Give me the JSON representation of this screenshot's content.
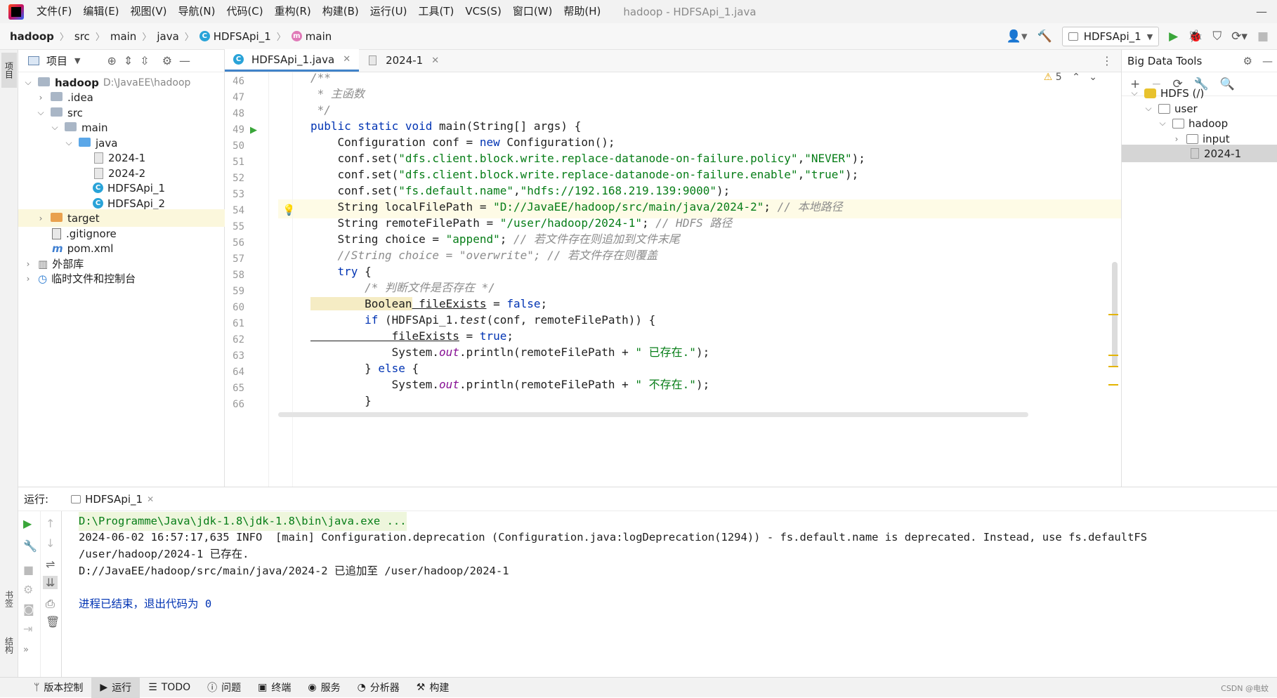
{
  "titlebar": {
    "menus": [
      "文件(F)",
      "编辑(E)",
      "视图(V)",
      "导航(N)",
      "代码(C)",
      "重构(R)",
      "构建(B)",
      "运行(U)",
      "工具(T)",
      "VCS(S)",
      "窗口(W)",
      "帮助(H)"
    ],
    "window_title": "hadoop - HDFSApi_1.java"
  },
  "breadcrumb": {
    "items": [
      "hadoop",
      "src",
      "main",
      "java",
      "HDFSApi_1",
      "main"
    ]
  },
  "run_toolbar": {
    "config": "HDFSApi_1"
  },
  "left_strip": {
    "project": "项目",
    "bookmarks": "书签",
    "structure": "结构"
  },
  "project": {
    "header": "项目",
    "root_name": "hadoop",
    "root_path": "D:\\JavaEE\\hadoop",
    "items": [
      ".idea",
      "src",
      "main",
      "java",
      "2024-1",
      "2024-2",
      "HDFSApi_1",
      "HDFSApi_2",
      "target",
      ".gitignore",
      "pom.xml",
      "外部库",
      "临时文件和控制台"
    ]
  },
  "tabs": [
    {
      "label": "HDFSApi_1.java"
    },
    {
      "label": "2024-1"
    }
  ],
  "editor": {
    "warnings": "5",
    "line_numbers": [
      "46",
      "47",
      "48",
      "49",
      "50",
      "51",
      "52",
      "53",
      "54",
      "55",
      "56",
      "57",
      "58",
      "59",
      "60",
      "61",
      "62",
      "63",
      "64",
      "65",
      "66"
    ]
  },
  "code": {
    "l46": "/**",
    "l47": " * 主函数",
    "l48": " */",
    "l49_kw": "public static void ",
    "l49_rest": "main(String[] args) {",
    "l50_a": "    Configuration conf = ",
    "l50_kw": "new",
    "l50_b": " Configuration();",
    "l51_a": "    conf.set(",
    "l51_s1": "\"dfs.client.block.write.replace-datanode-on-failure.policy\"",
    "l51_b": ",",
    "l51_s2": "\"NEVER\"",
    "l51_c": ");",
    "l52_a": "    conf.set(",
    "l52_s1": "\"dfs.client.block.write.replace-datanode-on-failure.enable\"",
    "l52_b": ",",
    "l52_s2": "\"true\"",
    "l52_c": ");",
    "l53_a": "    conf.set(",
    "l53_s1": "\"fs.default.name\"",
    "l53_b": ",",
    "l53_s2": "\"hdfs://192.168.219.139:9000\"",
    "l53_c": ");",
    "l54_a": "    String localFilePath = ",
    "l54_s": "\"D://JavaEE/hadoop/src/main/java/2024-2\"",
    "l54_b": "; ",
    "l54_c": "// 本地路径",
    "l55_a": "    String remoteFilePath = ",
    "l55_s": "\"/user/hadoop/2024-1\"",
    "l55_b": "; ",
    "l55_c": "// HDFS 路径",
    "l56_a": "    String choice = ",
    "l56_s": "\"append\"",
    "l56_b": "; ",
    "l56_c": "// 若文件存在则追加到文件末尾",
    "l57": "    //String choice = \"overwrite\"; // 若文件存在则覆盖",
    "l58_kw": "    try",
    "l58_b": " {",
    "l59": "        /* 判断文件是否存在 */",
    "l60_a": "        Boolean",
    "l60_b": " fileExists",
    "l60_c": " = ",
    "l60_kw": "false",
    "l60_d": ";",
    "l61_kw": "        if",
    "l61_a": " (HDFSApi_1.",
    "l61_i": "test",
    "l61_b": "(conf, remoteFilePath)) {",
    "l62_a": "            fileExists",
    "l62_b": " = ",
    "l62_kw": "true",
    "l62_c": ";",
    "l63_a": "            System.",
    "l63_f": "out",
    "l63_b": ".println(remoteFilePath + ",
    "l63_s": "\" 已存在.\"",
    "l63_c": ");",
    "l64_a": "        } ",
    "l64_kw": "else",
    "l64_b": " {",
    "l65_a": "            System.",
    "l65_f": "out",
    "l65_b": ".println(remoteFilePath + ",
    "l65_s": "\" 不存在.\"",
    "l65_c": ");",
    "l66": "        }"
  },
  "bigdata": {
    "title": "Big Data Tools",
    "tree": [
      "HDFS (/)",
      "user",
      "hadoop",
      "input",
      "2024-1"
    ]
  },
  "run": {
    "label": "运行:",
    "tab": "HDFSApi_1",
    "output": [
      "D:\\Programme\\Java\\jdk-1.8\\jdk-1.8\\bin\\java.exe ...",
      "2024-06-02 16:57:17,635 INFO  [main] Configuration.deprecation (Configuration.java:logDeprecation(1294)) - fs.default.name is deprecated. Instead, use fs.defaultFS",
      "/user/hadoop/2024-1 已存在.",
      "D://JavaEE/hadoop/src/main/java/2024-2 已追加至 /user/hadoop/2024-1",
      "",
      "进程已结束，退出代码为 0"
    ]
  },
  "statusbar": {
    "items": [
      "版本控制",
      "运行",
      "TODO",
      "问题",
      "终端",
      "服务",
      "分析器",
      "构建"
    ],
    "watermark": "CSDN @电蚊"
  },
  "colors": {
    "accent": "#4083c9",
    "keyword": "#0033b3",
    "string": "#067d17",
    "comment": "#8c8c8c",
    "run_green": "#3aa63a"
  }
}
